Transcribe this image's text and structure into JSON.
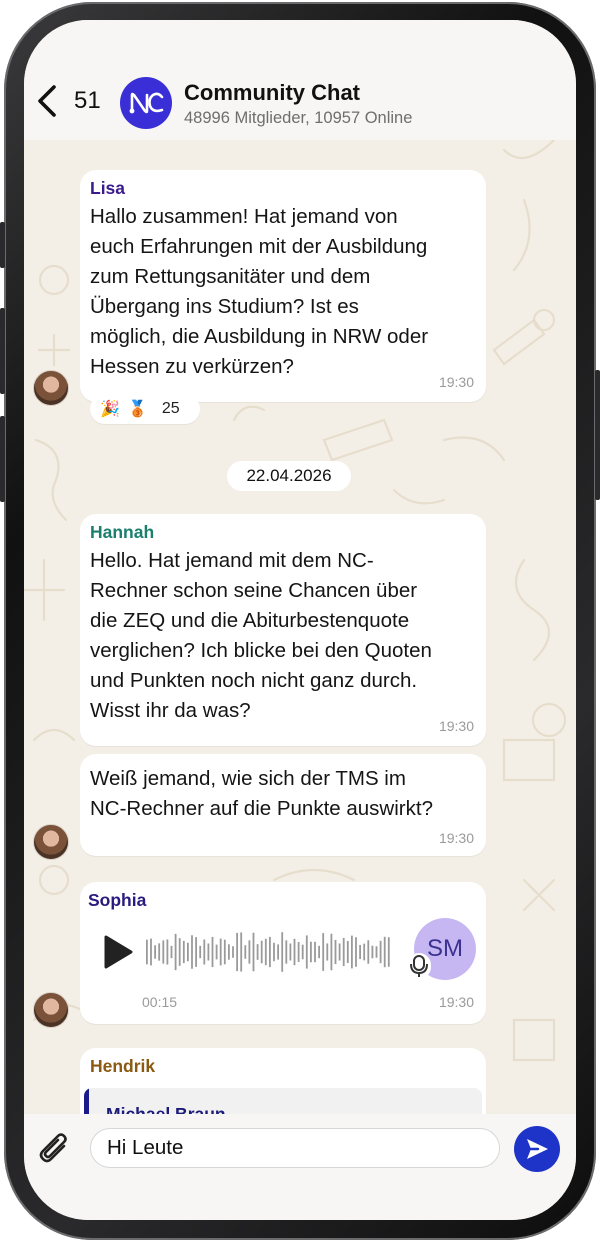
{
  "header": {
    "back_count": "51",
    "title": "Community Chat",
    "subtitle": "48996 Mitglieder, 10957 Online",
    "group_logo": "NC"
  },
  "messages": {
    "lisa": {
      "sender": "Lisa",
      "sender_color": "#3a1b8c",
      "text": "Hallo zusammen! Hat jemand von\neuch Erfahrungen mit der Ausbildung\nzum Rettungsanitäter und dem\nÜbergang ins Studium? Ist es\nmöglich, die Ausbildung in NRW oder\nHessen zu verkürzen?",
      "time": "19:30",
      "reactions": {
        "emoji_1": "🎉",
        "emoji_2": "🥉",
        "count": "25"
      }
    },
    "date_separator": "22.04.2026",
    "hannah": {
      "sender": "Hannah",
      "sender_color": "#1a7f6d",
      "text": "Hello. Hat jemand mit dem NC-\nRechner schon seine Chancen über\ndie ZEQ und die Abiturbestenquote\nverglichen? Ich blicke bei den Quoten\nund Punkten noch nicht ganz durch.\nWisst ihr da was?",
      "time": "19:30"
    },
    "hannah_2": {
      "text": "Weiß jemand, wie sich der TMS im\nNC-Rechner auf die Punkte auswirkt?",
      "time": "19:30"
    },
    "sophia": {
      "sender": "Sophia",
      "sender_color": "#2a1b7e",
      "duration": "00:15",
      "time": "19:30",
      "avatar_initials": "SM"
    },
    "hendrik": {
      "sender": "Hendrik",
      "sender_color": "#8a5a12",
      "reply_name": "Michael Braun"
    }
  },
  "composer": {
    "value": "Hi Leute",
    "send_color": "#1e34c8"
  }
}
